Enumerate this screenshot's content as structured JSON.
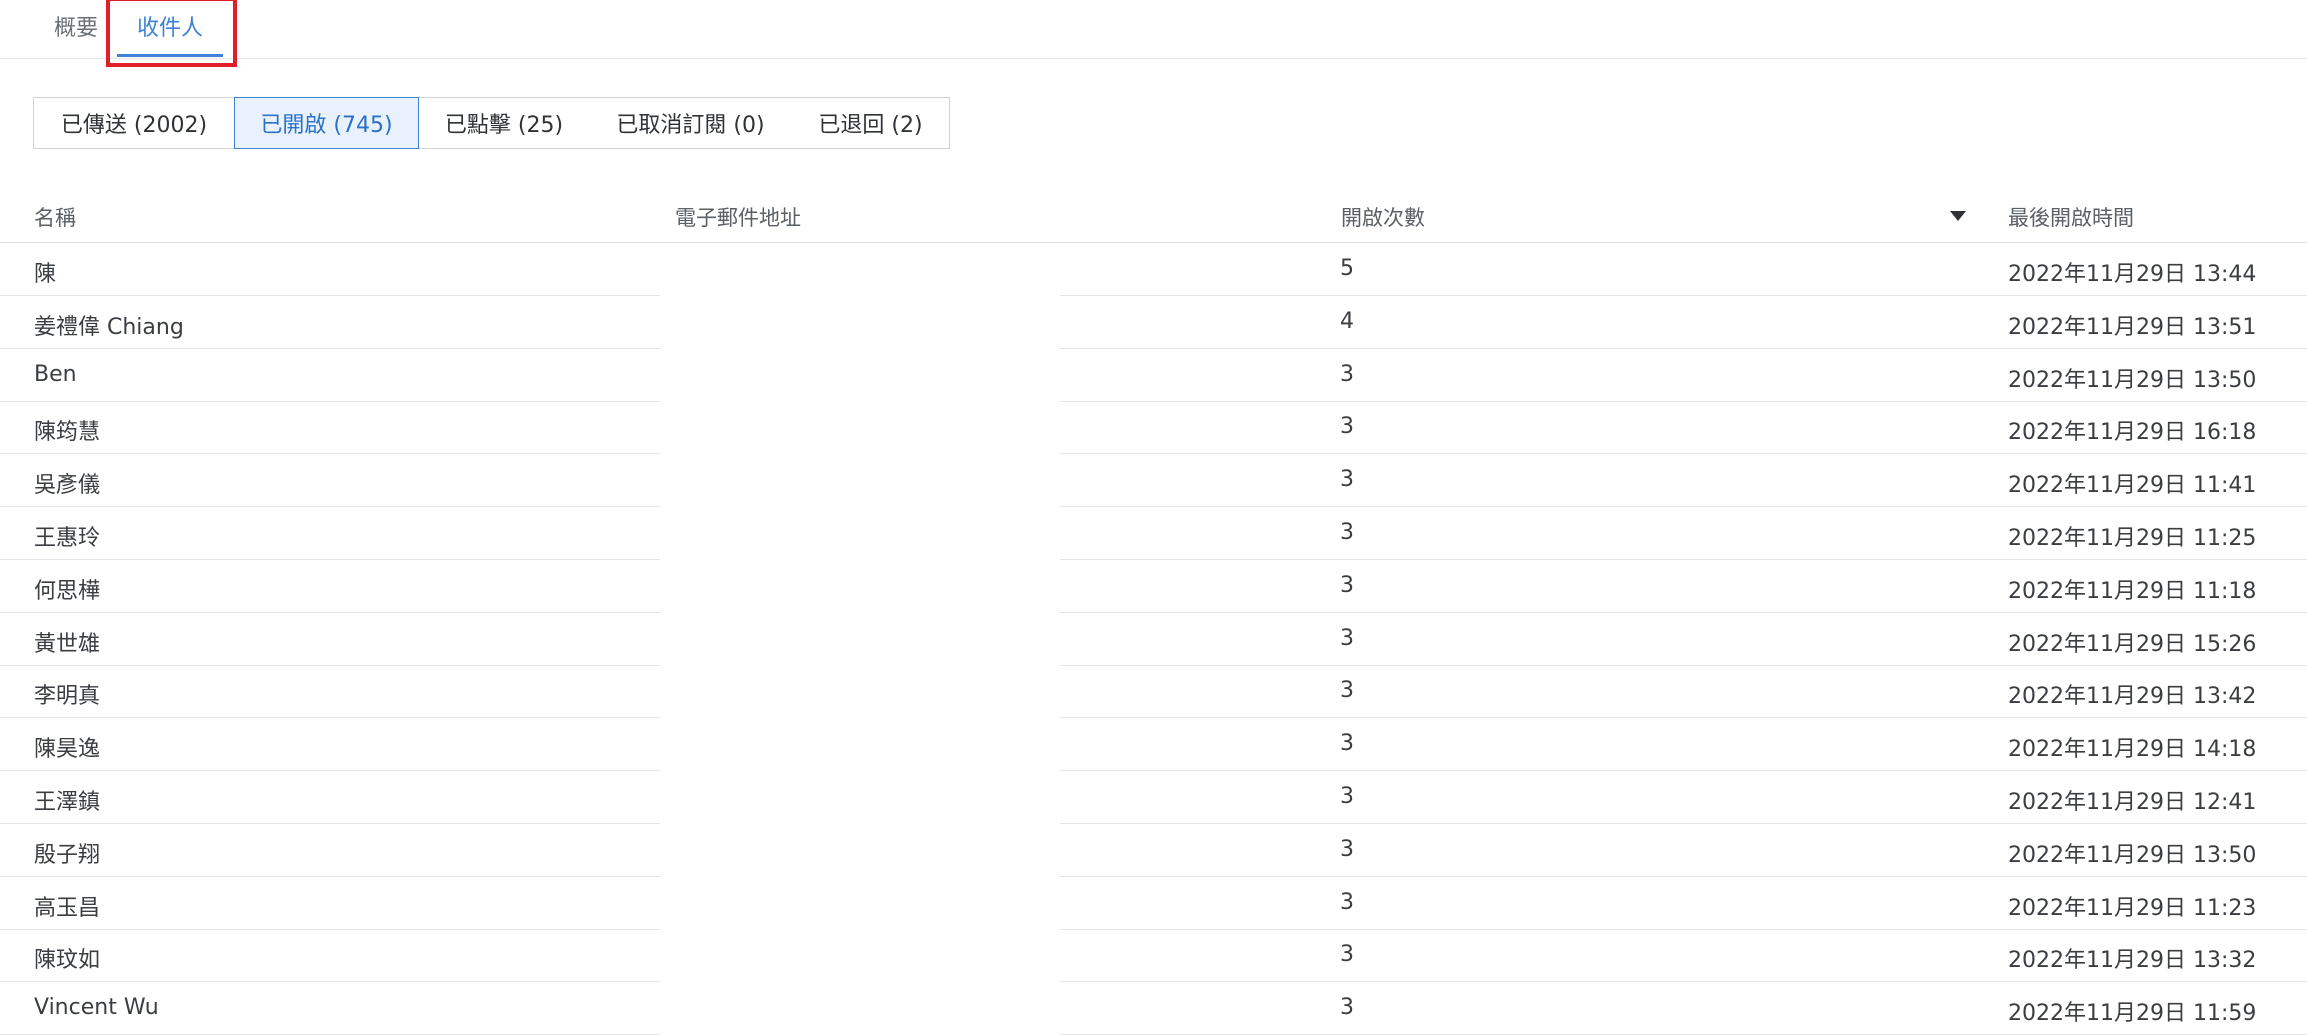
{
  "tabs": [
    {
      "label": "概要"
    },
    {
      "label": "收件人"
    }
  ],
  "filters": [
    {
      "label": "已傳送 (2002)"
    },
    {
      "label": "已開啟 (745)"
    },
    {
      "label": "已點擊 (25)"
    },
    {
      "label": "已取消訂閱 (0)"
    },
    {
      "label": "已退回 (2)"
    }
  ],
  "selected_filter": "已開啟 (745)",
  "table": {
    "headers": {
      "name": "名稱",
      "email": "電子郵件地址",
      "open_count": "開啟次數",
      "last_opened": "最後開啟時間"
    },
    "sort_icon": "caret-down-icon",
    "rows": [
      {
        "name": "陳",
        "email": "",
        "open_count": "5",
        "last_opened": "2022年11月29日 13:44"
      },
      {
        "name": "姜禮偉 Chiang",
        "email": "",
        "open_count": "4",
        "last_opened": "2022年11月29日 13:51"
      },
      {
        "name": "Ben",
        "email": "",
        "open_count": "3",
        "last_opened": "2022年11月29日 13:50"
      },
      {
        "name": "陳筠慧",
        "email": "",
        "open_count": "3",
        "last_opened": "2022年11月29日 16:18"
      },
      {
        "name": "吳彥儀",
        "email": "",
        "open_count": "3",
        "last_opened": "2022年11月29日 11:41"
      },
      {
        "name": "王惠玲",
        "email": "",
        "open_count": "3",
        "last_opened": "2022年11月29日 11:25"
      },
      {
        "name": "何思樺",
        "email": "",
        "open_count": "3",
        "last_opened": "2022年11月29日 11:18"
      },
      {
        "name": "黃世雄",
        "email": "",
        "open_count": "3",
        "last_opened": "2022年11月29日 15:26"
      },
      {
        "name": "李明真",
        "email": "",
        "open_count": "3",
        "last_opened": "2022年11月29日 13:42"
      },
      {
        "name": "陳昊逸",
        "email": "",
        "open_count": "3",
        "last_opened": "2022年11月29日 14:18"
      },
      {
        "name": "王澤鎮",
        "email": "",
        "open_count": "3",
        "last_opened": "2022年11月29日 12:41"
      },
      {
        "name": "殷子翔",
        "email": "",
        "open_count": "3",
        "last_opened": "2022年11月29日 13:50"
      },
      {
        "name": "高玉昌",
        "email": "",
        "open_count": "3",
        "last_opened": "2022年11月29日 11:23"
      },
      {
        "name": "陳玟如",
        "email": "",
        "open_count": "3",
        "last_opened": "2022年11月29日 13:32"
      },
      {
        "name": "Vincent Wu",
        "email": "",
        "open_count": "3",
        "last_opened": "2022年11月29日 11:59"
      }
    ]
  },
  "colors": {
    "accent": "#3d82d6",
    "highlight_box": "#e01f2a",
    "selected_filter_bg": "#e9f2fc"
  }
}
